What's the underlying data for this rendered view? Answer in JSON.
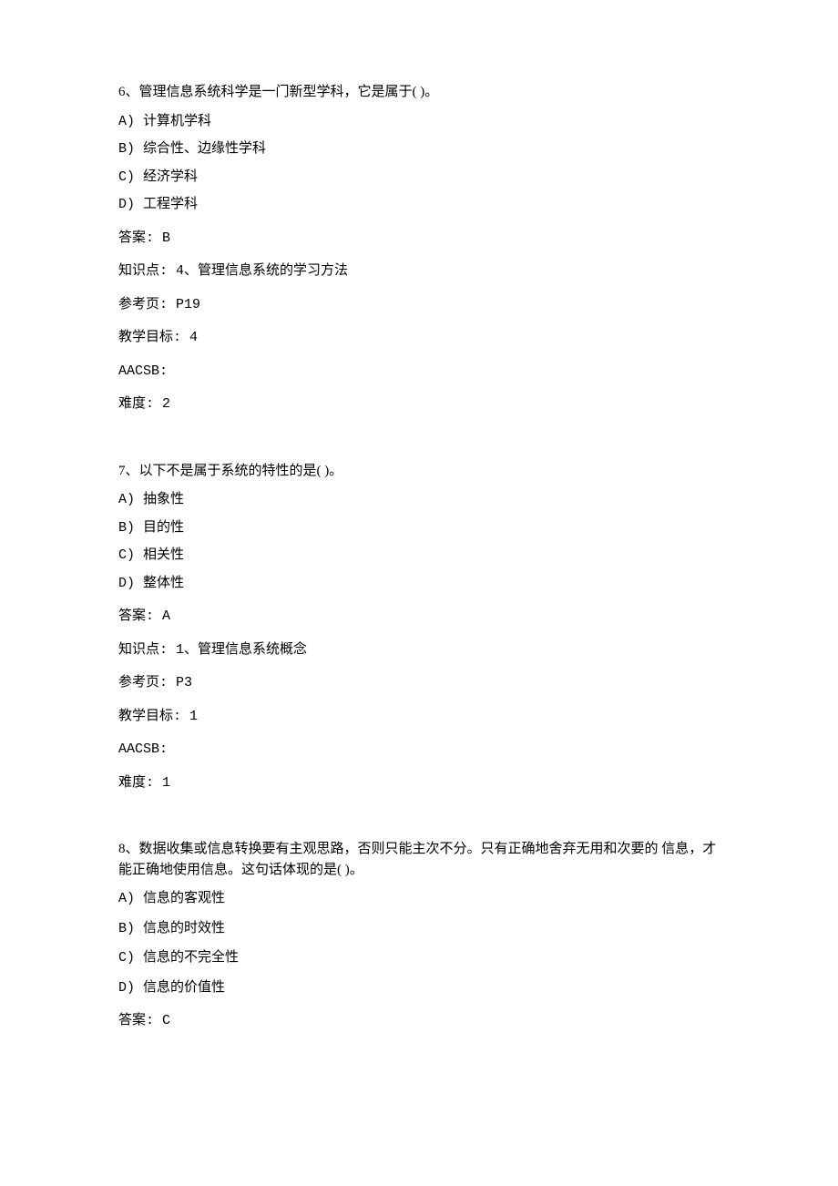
{
  "questions": [
    {
      "number": "6",
      "stem": "、管理信息系统科学是一门新型学科，它是属于( )。",
      "options": {
        "a": "A)  计算机学科",
        "b": "B)  综合性、边缘性学科",
        "c": "C)  经济学科",
        "d": "D)  工程学科"
      },
      "answer": "答案: B",
      "knowledge": "知识点: 4、管理信息系统的学习方法",
      "reference": "参考页: P19",
      "objective": "教学目标: 4",
      "aacsb": "AACSB:",
      "difficulty": "难度: 2"
    },
    {
      "number": "7",
      "stem": "、以下不是属于系统的特性的是( )。",
      "options": {
        "a": "A)  抽象性",
        "b": "B)  目的性",
        "c": "C)  相关性",
        "d": "D)  整体性"
      },
      "answer": "答案: A",
      "knowledge": "知识点: 1、管理信息系统概念",
      "reference": "参考页: P3",
      "objective": "教学目标: 1",
      "aacsb": "AACSB:",
      "difficulty": "难度: 1"
    },
    {
      "number": "8",
      "stem": "、数据收集或信息转换要有主观思路，否则只能主次不分。只有正确地舍弃无用和次要的 信息，才能正确地使用信息。这句话体现的是( )。",
      "options": {
        "a": "A)  信息的客观性",
        "b": "B)  信息的时效性",
        "c": "C)  信息的不完全性",
        "d": "D)  信息的价值性"
      },
      "answer": "答案: C"
    }
  ]
}
